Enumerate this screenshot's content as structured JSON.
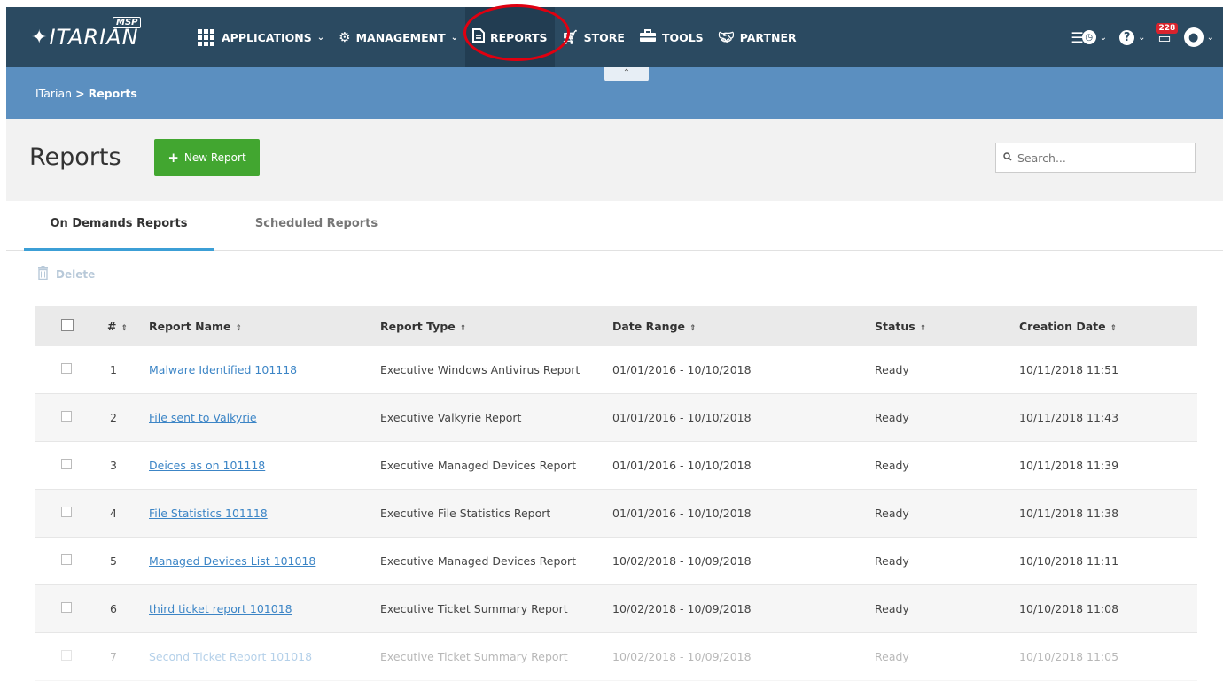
{
  "brand": {
    "name": "ITARIAN",
    "tag": "MSP"
  },
  "nav": {
    "items": [
      {
        "label": "APPLICATIONS",
        "icon": "apps-grid-icon",
        "has_dropdown": true
      },
      {
        "label": "MANAGEMENT",
        "icon": "gears-icon",
        "has_dropdown": true
      },
      {
        "label": "REPORTS",
        "icon": "document-icon",
        "active": true
      },
      {
        "label": "STORE",
        "icon": "cart-icon"
      },
      {
        "label": "TOOLS",
        "icon": "toolbox-icon"
      },
      {
        "label": "PARTNER",
        "icon": "handshake-icon"
      }
    ],
    "notification_count": "228"
  },
  "breadcrumb": {
    "root": "ITarian",
    "separator": ">",
    "current": "Reports"
  },
  "page": {
    "title": "Reports",
    "new_button": "New Report",
    "search_placeholder": "Search..."
  },
  "tabs": [
    {
      "label": "On Demands Reports",
      "active": true
    },
    {
      "label": "Scheduled Reports",
      "active": false
    }
  ],
  "toolbar": {
    "delete_label": "Delete"
  },
  "table": {
    "columns": [
      "#",
      "Report Name",
      "Report Type",
      "Date Range",
      "Status",
      "Creation Date"
    ],
    "rows": [
      {
        "num": "1",
        "name": "Malware Identified 101118",
        "type": "Executive Windows Antivirus Report",
        "range": "01/01/2016 - 10/10/2018",
        "status": "Ready",
        "created": "10/11/2018 11:51"
      },
      {
        "num": "2",
        "name": "File sent to Valkyrie",
        "type": "Executive Valkyrie Report",
        "range": "01/01/2016 - 10/10/2018",
        "status": "Ready",
        "created": "10/11/2018 11:43"
      },
      {
        "num": "3",
        "name": "Deices as on 101118",
        "type": "Executive Managed Devices Report",
        "range": "01/01/2016 - 10/10/2018",
        "status": "Ready",
        "created": "10/11/2018 11:39"
      },
      {
        "num": "4",
        "name": "File Statistics 101118",
        "type": "Executive File Statistics Report",
        "range": "01/01/2016 - 10/10/2018",
        "status": "Ready",
        "created": "10/11/2018 11:38"
      },
      {
        "num": "5",
        "name": "Managed Devices List 101018",
        "type": "Executive Managed Devices Report",
        "range": "10/02/2018 - 10/09/2018",
        "status": "Ready",
        "created": "10/10/2018 11:11"
      },
      {
        "num": "6",
        "name": "third ticket report 101018",
        "type": "Executive Ticket Summary Report",
        "range": "10/02/2018 - 10/09/2018",
        "status": "Ready",
        "created": "10/10/2018 11:08"
      },
      {
        "num": "7",
        "name": "Second Ticket Report 101018",
        "type": "Executive Ticket Summary Report",
        "range": "10/02/2018 - 10/09/2018",
        "status": "Ready",
        "created": "10/10/2018 11:05"
      }
    ]
  },
  "colors": {
    "nav_bg": "#2b4a61",
    "breadcrumb_bg": "#5b8fc0",
    "new_button": "#42a630",
    "active_tab_underline": "#3c9fd6",
    "link": "#3c85c6",
    "highlight_ring": "#e00010",
    "badge": "#d9232d"
  }
}
